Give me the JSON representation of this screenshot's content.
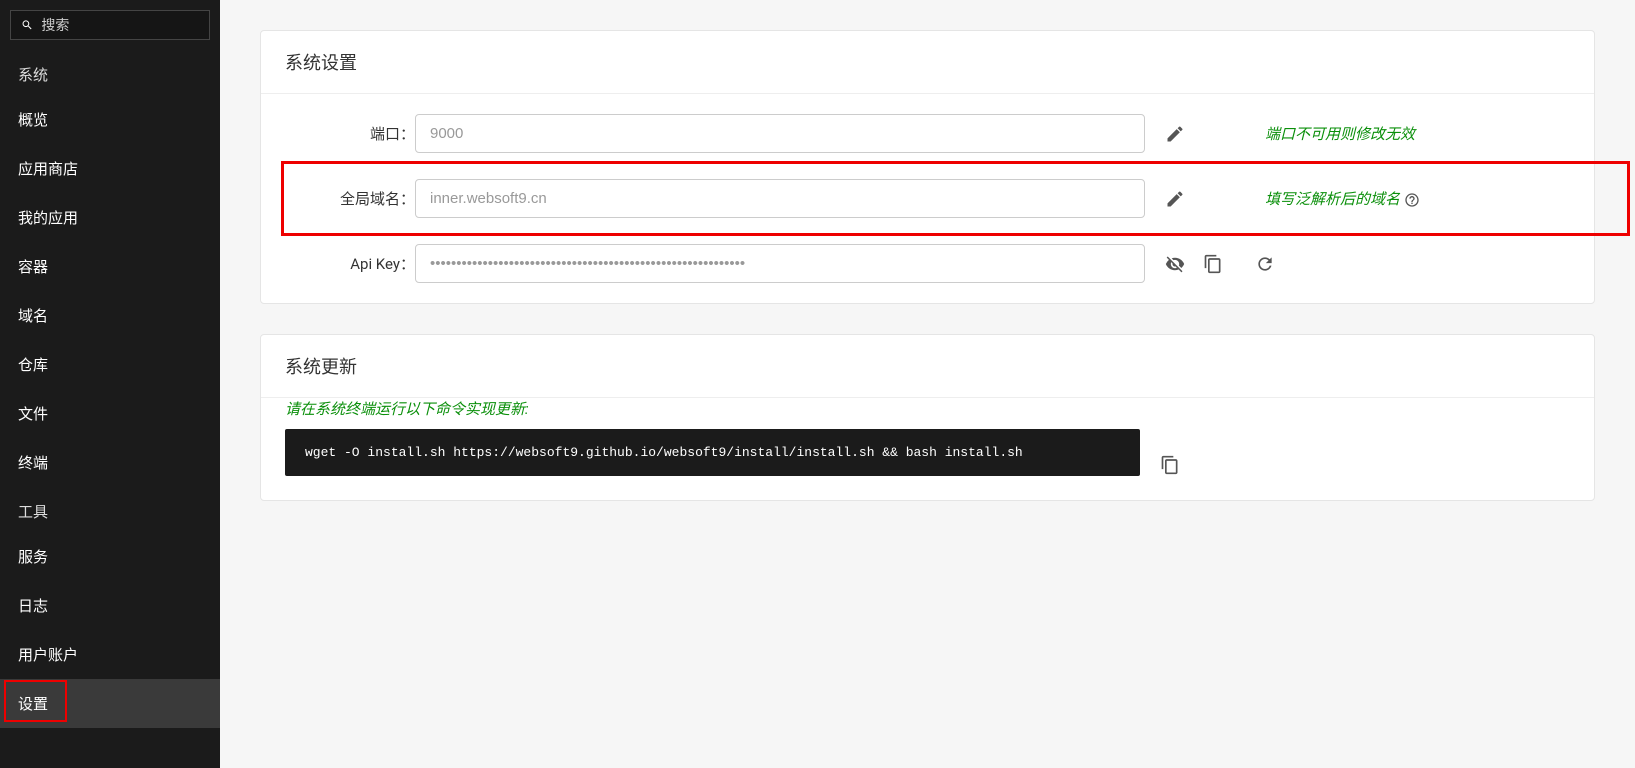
{
  "sidebar": {
    "search_placeholder": "搜索",
    "sections": [
      {
        "header": "系统",
        "items": [
          "概览",
          "应用商店",
          "我的应用",
          "容器",
          "域名",
          "仓库",
          "文件",
          "终端"
        ]
      },
      {
        "header": "工具",
        "items": [
          "服务",
          "日志",
          "用户账户",
          "设置"
        ]
      }
    ],
    "active": "设置"
  },
  "settings": {
    "title": "系统设置",
    "rows": [
      {
        "label": "端口：",
        "value": "9000",
        "hint": "端口不可用则修改无效",
        "icons": [
          "edit"
        ],
        "highlight": false
      },
      {
        "label": "全局域名：",
        "value": "inner.websoft9.cn",
        "hint": "填写泛解析后的域名",
        "hint_help": true,
        "icons": [
          "edit"
        ],
        "highlight": true
      },
      {
        "label": "Api Key：",
        "value": "",
        "masked": true,
        "icons": [
          "eye-off",
          "copy"
        ],
        "refresh": true
      }
    ]
  },
  "update": {
    "title": "系统更新",
    "message": "请在系统终端运行以下命令实现更新:",
    "command": "wget -O install.sh https://websoft9.github.io/websoft9/install/install.sh && bash install.sh"
  }
}
